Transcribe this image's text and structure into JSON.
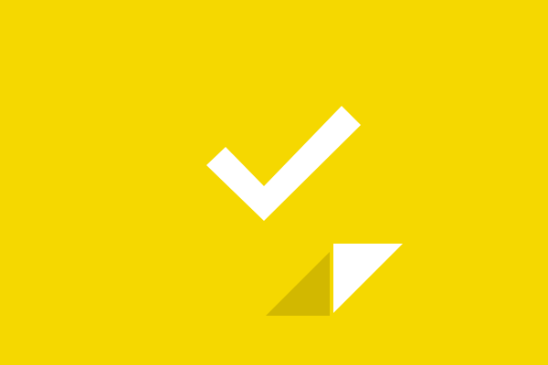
{
  "colors": {
    "background": "#F5D800",
    "checkmark": "#FFFFFF",
    "fold_shadow": "#D2B800",
    "fold_light": "#FFFFFF"
  },
  "icons": {
    "main": "checkmark-icon",
    "fold": "paper-fold-icon"
  }
}
